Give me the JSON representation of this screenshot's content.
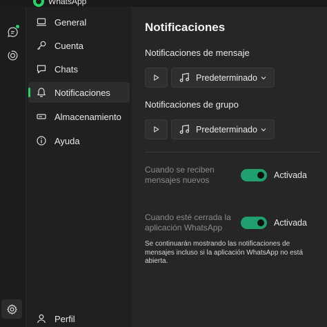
{
  "app": {
    "title": "WhatsApp"
  },
  "rail": {
    "icons": [
      "chats-icon",
      "status-icon",
      "settings-icon"
    ]
  },
  "nav": {
    "items": [
      {
        "label": "General",
        "icon": "laptop-icon"
      },
      {
        "label": "Cuenta",
        "icon": "key-icon"
      },
      {
        "label": "Chats",
        "icon": "chat-bubble-icon"
      },
      {
        "label": "Notificaciones",
        "icon": "bell-icon",
        "active": true
      },
      {
        "label": "Almacenamiento",
        "icon": "storage-icon"
      },
      {
        "label": "Ayuda",
        "icon": "info-icon"
      }
    ],
    "profile": {
      "label": "Perfil",
      "icon": "person-icon"
    }
  },
  "main": {
    "title": "Notificaciones",
    "message_section": {
      "label": "Notificaciones de mensaje",
      "sound": "Predeterminado"
    },
    "group_section": {
      "label": "Notificaciones de grupo",
      "sound": "Predeterminado"
    },
    "toggles": [
      {
        "label": "Cuando se reciben mensajes nuevos",
        "state": "Activada",
        "on": true
      },
      {
        "label": "Cuando esté cerrada la aplicación WhatsApp",
        "state": "Activada",
        "on": true
      }
    ],
    "footnote": "Se continuarán mostrando las notificaciones de mensajes incluso si la aplicación WhatsApp no está abierta."
  },
  "colors": {
    "accent": "#25d366",
    "toggle_on": "#1fa06e"
  }
}
